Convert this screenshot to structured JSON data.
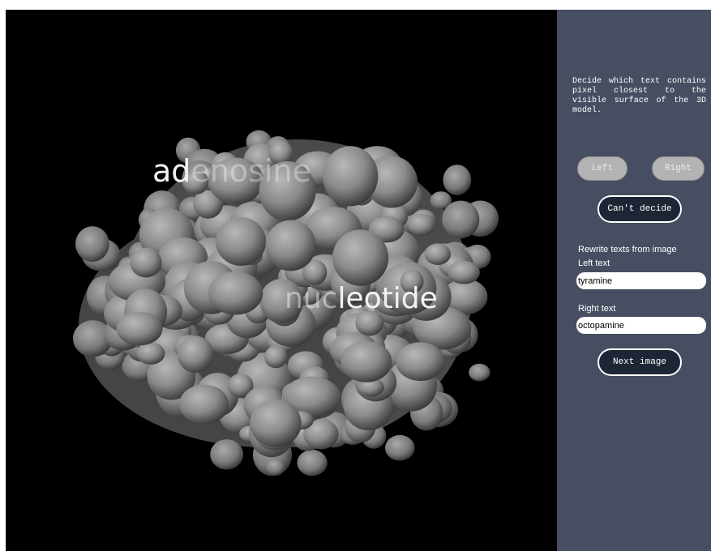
{
  "scene": {
    "words": {
      "left": "adenosine",
      "right": "nucleotide"
    }
  },
  "panel": {
    "instructions": "Decide which text contains pixel closest to the visible surface of the 3D model.",
    "buttons": {
      "left": "Left",
      "right": "Right",
      "cant_decide": "Can't decide",
      "next": "Next image"
    },
    "rewrite_heading": "Rewrite texts from image",
    "left_text_label": "Left text",
    "left_text_value": "tyramine",
    "right_text_label": "Right text",
    "right_text_value": "octopamine"
  },
  "colors": {
    "panel_bg": "#474e61",
    "viewport_bg": "#000000",
    "model": "#8a8a8a",
    "dark_button": "#1e2534",
    "disabled_button": "#b3b3b3"
  }
}
